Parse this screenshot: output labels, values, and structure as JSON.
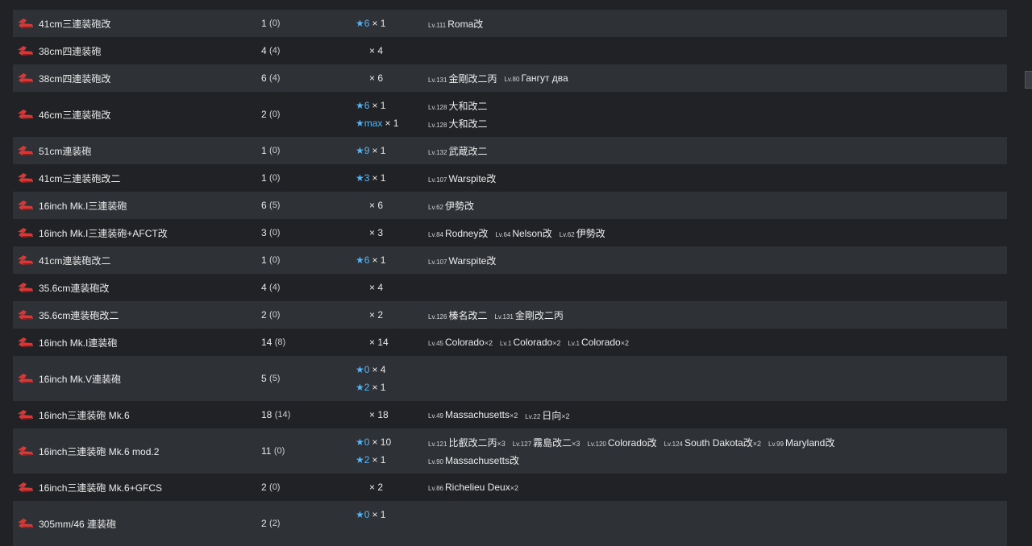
{
  "rows": [
    {
      "name": "",
      "count": "",
      "sub": "",
      "stars": [],
      "ships": [
        []
      ]
    },
    {
      "name": "41cm三連装砲改",
      "count": "1",
      "sub": "(0)",
      "stars": [
        {
          "star": "★6",
          "mult": "× 1"
        }
      ],
      "ships": [
        [
          {
            "lv": "Lv.111",
            "name": "Roma改",
            "dup": ""
          }
        ]
      ]
    },
    {
      "name": "38cm四連装砲",
      "count": "4",
      "sub": "(4)",
      "stars": [
        {
          "star": "",
          "mult": "× 4"
        }
      ],
      "ships": [
        []
      ]
    },
    {
      "name": "38cm四連装砲改",
      "count": "6",
      "sub": "(4)",
      "stars": [
        {
          "star": "",
          "mult": "× 6"
        }
      ],
      "ships": [
        [
          {
            "lv": "Lv.131",
            "name": "金剛改二丙",
            "dup": ""
          },
          {
            "lv": "Lv.80",
            "name": "Гангут два",
            "dup": ""
          }
        ]
      ]
    },
    {
      "name": "46cm三連装砲改",
      "count": "2",
      "sub": "(0)",
      "stars": [
        {
          "star": "★6",
          "mult": "× 1"
        },
        {
          "star": "★max",
          "mult": "× 1"
        }
      ],
      "ships": [
        [
          {
            "lv": "Lv.128",
            "name": "大和改二",
            "dup": ""
          }
        ],
        [
          {
            "lv": "Lv.128",
            "name": "大和改二",
            "dup": ""
          }
        ]
      ]
    },
    {
      "name": "51cm連装砲",
      "count": "1",
      "sub": "(0)",
      "stars": [
        {
          "star": "★9",
          "mult": "× 1"
        }
      ],
      "ships": [
        [
          {
            "lv": "Lv.132",
            "name": "武蔵改二",
            "dup": ""
          }
        ]
      ]
    },
    {
      "name": "41cm三連装砲改二",
      "count": "1",
      "sub": "(0)",
      "stars": [
        {
          "star": "★3",
          "mult": "× 1"
        }
      ],
      "ships": [
        [
          {
            "lv": "Lv.107",
            "name": "Warspite改",
            "dup": ""
          }
        ]
      ]
    },
    {
      "name": "16inch Mk.I三連装砲",
      "count": "6",
      "sub": "(5)",
      "stars": [
        {
          "star": "",
          "mult": "× 6"
        }
      ],
      "ships": [
        [
          {
            "lv": "Lv.62",
            "name": "伊勢改",
            "dup": ""
          }
        ]
      ]
    },
    {
      "name": "16inch Mk.I三連装砲+AFCT改",
      "count": "3",
      "sub": "(0)",
      "stars": [
        {
          "star": "",
          "mult": "× 3"
        }
      ],
      "ships": [
        [
          {
            "lv": "Lv.84",
            "name": "Rodney改",
            "dup": ""
          },
          {
            "lv": "Lv.64",
            "name": "Nelson改",
            "dup": ""
          },
          {
            "lv": "Lv.62",
            "name": "伊勢改",
            "dup": ""
          }
        ]
      ]
    },
    {
      "name": "41cm連装砲改二",
      "count": "1",
      "sub": "(0)",
      "stars": [
        {
          "star": "★6",
          "mult": "× 1"
        }
      ],
      "ships": [
        [
          {
            "lv": "Lv.107",
            "name": "Warspite改",
            "dup": ""
          }
        ]
      ]
    },
    {
      "name": "35.6cm連装砲改",
      "count": "4",
      "sub": "(4)",
      "stars": [
        {
          "star": "",
          "mult": "× 4"
        }
      ],
      "ships": [
        []
      ]
    },
    {
      "name": "35.6cm連装砲改二",
      "count": "2",
      "sub": "(0)",
      "stars": [
        {
          "star": "",
          "mult": "× 2"
        }
      ],
      "ships": [
        [
          {
            "lv": "Lv.126",
            "name": "榛名改二",
            "dup": ""
          },
          {
            "lv": "Lv.131",
            "name": "金剛改二丙",
            "dup": ""
          }
        ]
      ]
    },
    {
      "name": "16inch Mk.I連装砲",
      "count": "14",
      "sub": "(8)",
      "stars": [
        {
          "star": "",
          "mult": "× 14"
        }
      ],
      "ships": [
        [
          {
            "lv": "Lv.45",
            "name": "Colorado",
            "dup": "×2"
          },
          {
            "lv": "Lv.1",
            "name": "Colorado",
            "dup": "×2"
          },
          {
            "lv": "Lv.1",
            "name": "Colorado",
            "dup": "×2"
          }
        ]
      ]
    },
    {
      "name": "16inch Mk.V連装砲",
      "count": "5",
      "sub": "(5)",
      "stars": [
        {
          "star": "★0",
          "mult": "× 4"
        },
        {
          "star": "★2",
          "mult": "× 1"
        }
      ],
      "ships": [
        [],
        []
      ]
    },
    {
      "name": "16inch三連装砲 Mk.6",
      "count": "18",
      "sub": "(14)",
      "stars": [
        {
          "star": "",
          "mult": "× 18"
        }
      ],
      "ships": [
        [
          {
            "lv": "Lv.49",
            "name": "Massachusetts",
            "dup": "×2"
          },
          {
            "lv": "Lv.22",
            "name": "日向",
            "dup": "×2"
          }
        ]
      ]
    },
    {
      "name": "16inch三連装砲 Mk.6 mod.2",
      "count": "11",
      "sub": "(0)",
      "stars": [
        {
          "star": "★0",
          "mult": "× 10"
        },
        {
          "star": "★2",
          "mult": "× 1"
        }
      ],
      "ships": [
        [
          {
            "lv": "Lv.121",
            "name": "比叡改二丙",
            "dup": "×3"
          },
          {
            "lv": "Lv.127",
            "name": "霧島改二",
            "dup": "×3"
          },
          {
            "lv": "Lv.120",
            "name": "Colorado改",
            "dup": ""
          },
          {
            "lv": "Lv.124",
            "name": "South Dakota改",
            "dup": "×2"
          },
          {
            "lv": "Lv.99",
            "name": "Maryland改",
            "dup": ""
          }
        ],
        [
          {
            "lv": "Lv.90",
            "name": "Massachusetts改",
            "dup": ""
          }
        ]
      ]
    },
    {
      "name": "16inch三連装砲 Mk.6+GFCS",
      "count": "2",
      "sub": "(0)",
      "stars": [
        {
          "star": "",
          "mult": "× 2"
        }
      ],
      "ships": [
        [
          {
            "lv": "Lv.86",
            "name": "Richelieu Deux",
            "dup": "×2"
          }
        ]
      ]
    },
    {
      "name": "305mm/46 連装砲",
      "count": "2",
      "sub": "(2)",
      "stars": [
        {
          "star": "★0",
          "mult": "× 1"
        },
        {
          "star": "",
          "mult": ""
        }
      ],
      "ships": [
        [],
        []
      ]
    }
  ],
  "colors": {
    "row_odd": "#2e3136",
    "row_even": "#202225",
    "star": "#5ab4f0",
    "icon": "#d23a3a"
  },
  "icon_name": "large-caliber-gun-icon"
}
